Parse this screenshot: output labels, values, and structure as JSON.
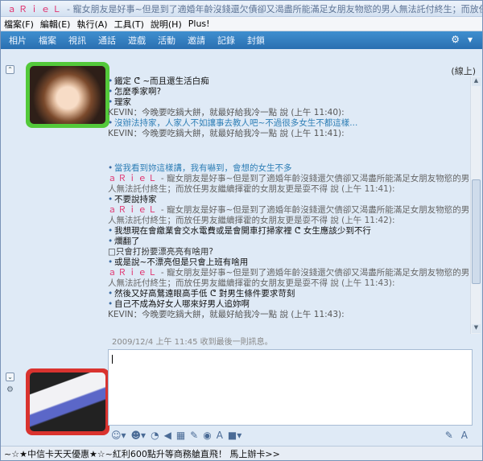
{
  "window": {
    "title_name": "ａＲｉｅＬ",
    "title_status": "- 寵女朋友是好事~但是到了適婚年齡沒錢還欠債卻又渴盡所能滿足女朋友物慾的男人無法託付終生；而放任男..."
  },
  "menu": [
    "檔案(F)",
    "編輯(E)",
    "執行(A)",
    "工具(T)",
    "說明(H)",
    "Plus!"
  ],
  "toolbar": [
    "相片",
    "檔案",
    "視訊",
    "通話",
    "遊戲",
    "活動",
    "邀請",
    "記錄",
    "封鎖"
  ],
  "status_label": "(線上)",
  "conversation": [
    {
      "type": "bullet",
      "text": "鐵定 ᕦ ~而且還生活白痴"
    },
    {
      "type": "bullet",
      "text": "怎麼季家啊?"
    },
    {
      "type": "bullet",
      "text": "理家"
    },
    {
      "type": "kevin",
      "text": "KEVIN：今晚要吃鍋大餅，就最好給我冷一點 說 (上午 11:40):"
    },
    {
      "type": "bullet-blue",
      "text": "沒辦法持家，人家人不如讓事去教人吧~不過很多女生不都這樣..."
    },
    {
      "type": "kevin",
      "text": "KEVIN：今晚要吃鍋大餅，就最好給我冷一點 說 (上午 11:41):"
    },
    {
      "type": "spacer",
      "text": ""
    },
    {
      "type": "bullet-blue",
      "text": "當我看到妳這樣講，我有嚇到，會想的女生不多"
    },
    {
      "type": "ariel",
      "sender": "ａＲｉｅＬ",
      "text": " - 寵女朋友是好事~但是到了適婚年齡沒錢還欠債卻又渴盡所能滿足女朋友物慾的男人無法託付終生；而放任男友繼續揮霍的女朋友更是耍不得 說 (上午 11:41):"
    },
    {
      "type": "bullet",
      "text": "不要說持家"
    },
    {
      "type": "ariel",
      "sender": "ａＲｉｅＬ",
      "text": " - 寵女朋友是好事~但是到了適婚年齡沒錢還欠債卻又渴盡所能滿足女朋友物慾的男人無法託付終生；而放任男友繼續揮霍的女朋友更是耍不得 說 (上午 11:42):"
    },
    {
      "type": "bullet",
      "text": "我想現在會繳業會交水電費或是會開車打掃家裡 ᕦ 女生應該少到不行"
    },
    {
      "type": "bullet",
      "text": "爛翻了"
    },
    {
      "type": "plain",
      "text": "□只會打扮要漂亮亮有啥用?"
    },
    {
      "type": "bullet",
      "text": "或是說~不漂亮但是只會上班有啥用"
    },
    {
      "type": "ariel",
      "sender": "ａＲｉｅＬ",
      "text": " - 寵女朋友是好事~但是到了適婚年齡沒錢還欠債卻又渴盡所能滿足女朋友物慾的男人無法託付終生；而放任男友繼續揮霍的女朋友更是耍不得 說 (上午 11:43):"
    },
    {
      "type": "bullet",
      "text": "然後又好高鶩遠眼高手低 ᕦ 對男生條件要求苛刻"
    },
    {
      "type": "bullet",
      "text": "自己不成為好女人哪來好男人追妳啊"
    },
    {
      "type": "kevin",
      "text": "KEVIN：今晚要吃鍋大餅，就最好給我冷一點 說 (上午 11:43):"
    }
  ],
  "last_message_info": "2009/12/4 上午 11:45 收到最後一則訊息。",
  "ad_text": "~☆★中信卡天天優惠★☆~紅利600點升等商務艙直飛！ 馬上辦卡>>",
  "colors": {
    "title_name": "#e0306d",
    "toolbar_bg": "#2a6fb1",
    "online_frame": "#53c93a",
    "self_frame": "#d9332f"
  }
}
